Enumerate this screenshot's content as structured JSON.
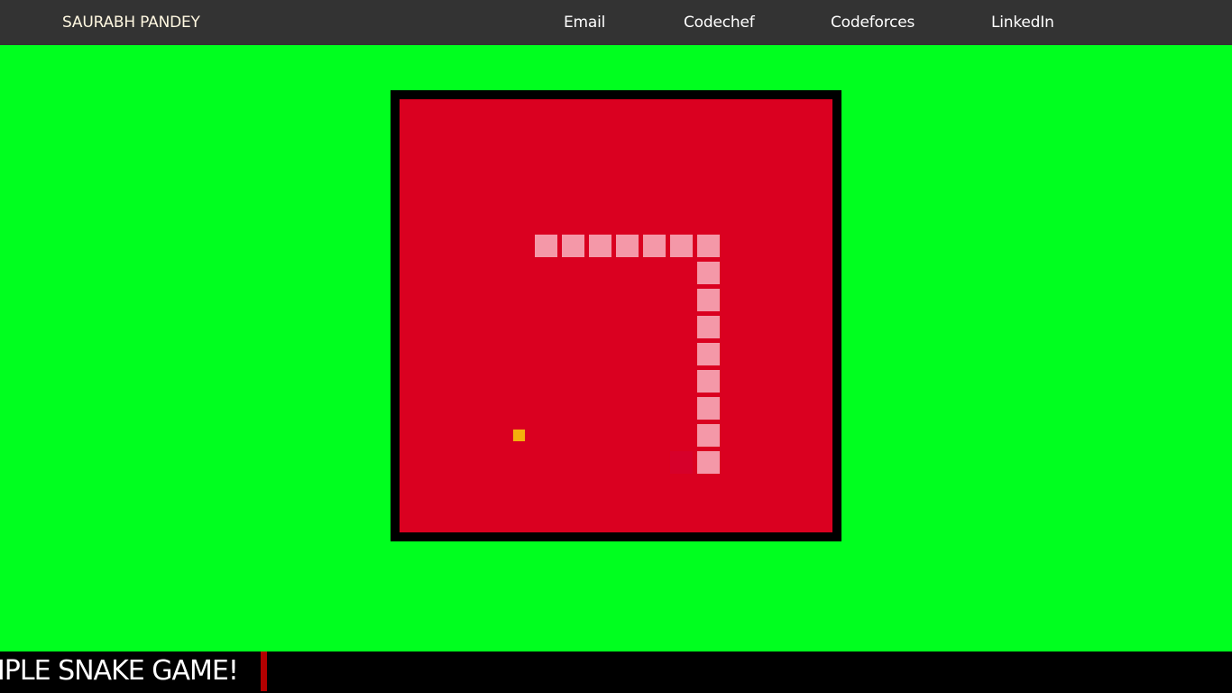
{
  "nav": {
    "brand": "SAURABH PANDEY",
    "links": [
      {
        "label": "Email"
      },
      {
        "label": "Codechef"
      },
      {
        "label": "Codeforces"
      },
      {
        "label": "LinkedIn"
      }
    ]
  },
  "game": {
    "grid_size": 16,
    "snake": [
      [
        5,
        5
      ],
      [
        6,
        5
      ],
      [
        7,
        5
      ],
      [
        8,
        5
      ],
      [
        9,
        5
      ],
      [
        10,
        5
      ],
      [
        11,
        5
      ],
      [
        11,
        6
      ],
      [
        11,
        7
      ],
      [
        11,
        8
      ],
      [
        11,
        9
      ],
      [
        11,
        10
      ],
      [
        11,
        11
      ],
      [
        11,
        12
      ],
      [
        11,
        13
      ]
    ],
    "trail": [
      [
        10,
        13
      ]
    ],
    "food": [
      4,
      12
    ],
    "colors": {
      "page": "#00ff1f",
      "frame": "#000000",
      "board": "#da0020",
      "snake": "#f498a8",
      "food": "#f4b00c"
    }
  },
  "footer": {
    "marquee_text": "SIMPLE SNAKE GAME!"
  }
}
